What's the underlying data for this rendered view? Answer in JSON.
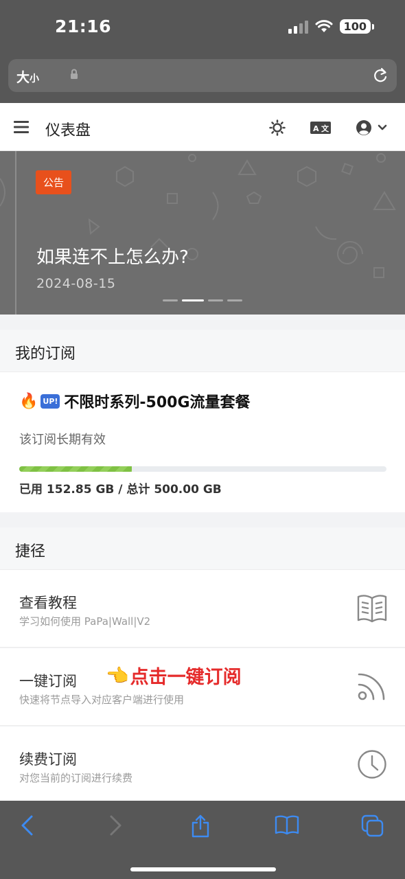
{
  "status_bar": {
    "time": "21:16",
    "battery": "100"
  },
  "url_bar": {
    "text_size_label": "大",
    "text_size_small": "小"
  },
  "header": {
    "title": "仪表盘"
  },
  "banner": {
    "badge": "公告",
    "title": "如果连不上怎么办?",
    "date": "2024-08-15",
    "slides": 4,
    "active_slide": 2
  },
  "subscription": {
    "section_title": "我的订阅",
    "plan_emoji": "🔥",
    "plan_badge": "UP!",
    "plan_name": "不限时系列-500G流量套餐",
    "validity": "该订阅长期有效",
    "used_fraction": 0.3057,
    "usage_text": "已用 152.85 GB / 总计 500.00 GB"
  },
  "shortcuts": {
    "section_title": "捷径",
    "items": [
      {
        "title": "查看教程",
        "desc": "学习如何使用 PaPa|Wall|V2",
        "icon": "book-icon"
      },
      {
        "title": "一键订阅",
        "desc": "快速将节点导入对应客户端进行使用",
        "icon": "rss-icon"
      },
      {
        "title": "续费订阅",
        "desc": "对您当前的订阅进行续费",
        "icon": "clock-icon"
      }
    ],
    "annotation": {
      "emoji": "👈",
      "text": "点击一键订阅"
    }
  },
  "colors": {
    "accent_badge": "#e8501c",
    "progress": "#7fc144",
    "annotation": "#e52b2b",
    "browser_blue": "#3d8bf2"
  }
}
